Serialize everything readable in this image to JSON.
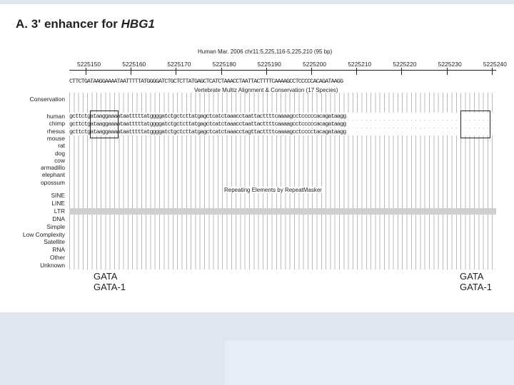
{
  "figure": {
    "title_prefix": "A. 3' enhancer for ",
    "title_gene": "HBG1"
  },
  "browser": {
    "assembly_label": "Human Mar. 2006   chr11:5,225,116-5,225,210 (95 bp)",
    "positions": [
      "5225150",
      "5225160",
      "5225170",
      "5225180",
      "5225190",
      "5225200",
      "5225210",
      "5225220",
      "5225230",
      "5225240"
    ],
    "reference_sequence": "CTTCTGATAAGGAAAATAATTTTTATGGGGATCTGCTCTTATGAGCTCATCTAAACCTAATTACTTTTCAAAAGCCTCCCCCACAGATAAGG",
    "alignment_title": "Vertebrate Multiz Alignment & Conservation (17 Species)",
    "conservation_label": "Conservation",
    "species": [
      "human",
      "chimp",
      "rhesus",
      "mouse",
      "rat",
      "dog",
      "cow",
      "armadillo",
      "elephant",
      "opossum"
    ],
    "aligned_sequences": {
      "human": "gcttctgataaggaaaataatttttatggggatctgctcttatgagctcatctaaacctaattacttttcaaaagcctcccccacagataagg",
      "chimp": "gcttctgataaggaaaataatttttatggggatctgctcttatgagctcatctaaacctaattacttttcaaaagcctcccccacagataagg",
      "rhesus": "gcttctgataaggaaaataatttttatggggatctgctcttatgagctcatctaaacctagttacttttcaaaagcctcccctacagataagg"
    },
    "repeat_title": "Repeating Elements by RepeatMasker",
    "repeat_classes": [
      "SINE",
      "LINE",
      "LTR",
      "DNA",
      "Simple",
      "Low Complexity",
      "Satellite",
      "RNA",
      "Other",
      "Unknown"
    ]
  },
  "annotations": {
    "left": [
      "GATA",
      "GATA-1"
    ],
    "right": [
      "GATA",
      "GATA-1"
    ]
  },
  "colors": {
    "ltr_bar": "#cfcfcf",
    "background": "#dfe6ef"
  }
}
